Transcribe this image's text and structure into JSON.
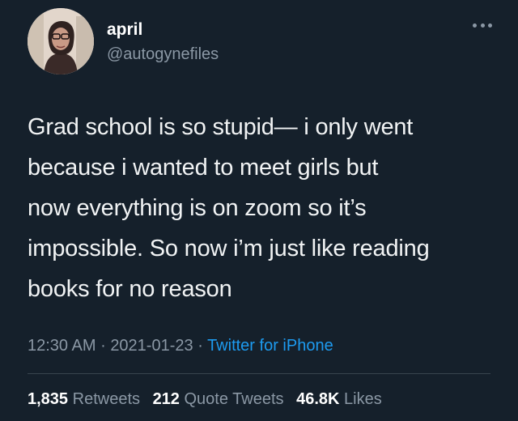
{
  "user": {
    "display_name": "april",
    "handle": "@autogynefiles"
  },
  "icons": {
    "more": "more-horizontal-icon",
    "avatar": "profile-photo"
  },
  "tweet": {
    "lines": [
      "Grad school is so stupid— i only went",
      "because i wanted to meet girls but",
      "now everything is on zoom so it’s",
      "impossible. So now i’m just like reading",
      "books for no reason"
    ],
    "time": "12:30 AM",
    "date": "2021-01-23",
    "separator": "·",
    "source": "Twitter for iPhone"
  },
  "stats": {
    "retweets_count": "1,835",
    "retweets_label": "Retweets",
    "quote_count": "212",
    "quote_label": "Quote Tweets",
    "likes_count": "46.8K",
    "likes_label": "Likes"
  },
  "colors": {
    "background": "#15202b",
    "text": "#e7e9ea",
    "secondary": "#8b98a5",
    "link": "#1d9bf0"
  }
}
